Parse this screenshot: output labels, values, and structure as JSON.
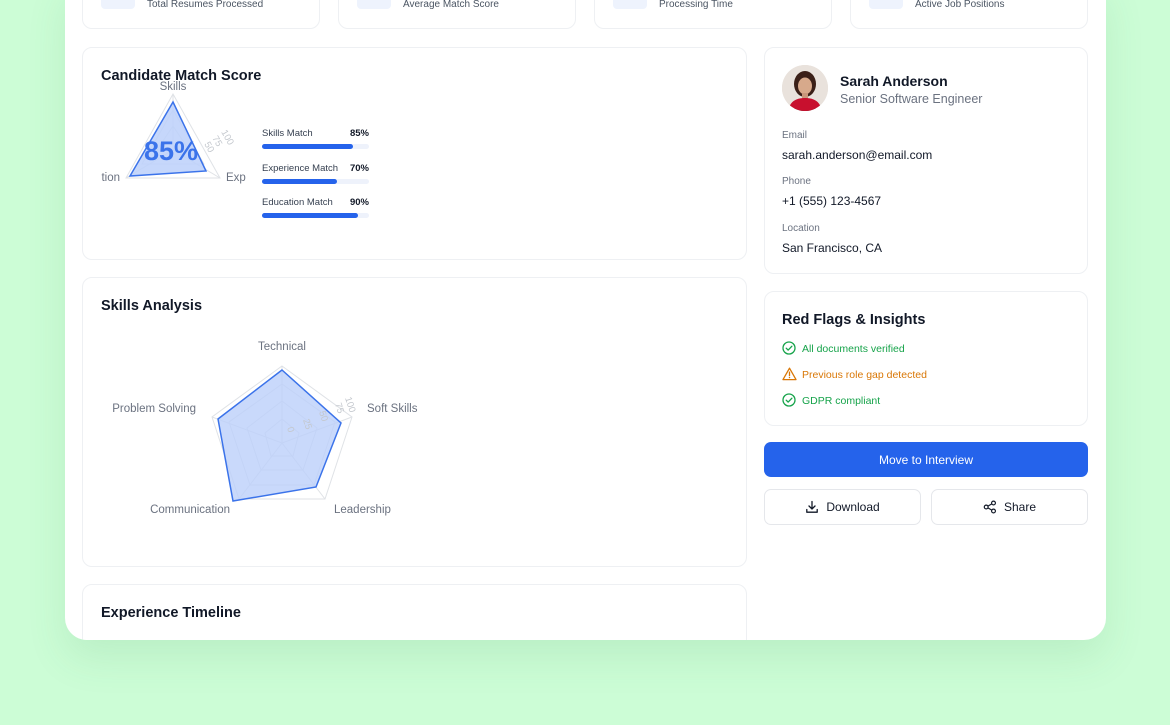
{
  "stats": [
    {
      "label": "Total Resumes Processed"
    },
    {
      "label": "Average Match Score"
    },
    {
      "label": "Processing Time"
    },
    {
      "label": "Active Job Positions"
    }
  ],
  "match_card": {
    "title": "Candidate Match Score",
    "radar_value": "85%",
    "axes": [
      "Skills",
      "Exp",
      "tion"
    ],
    "ticks": [
      "100",
      "75",
      "50"
    ],
    "bars": [
      {
        "label": "Skills Match",
        "value_text": "85%",
        "value": 85
      },
      {
        "label": "Experience Match",
        "value_text": "70%",
        "value": 70
      },
      {
        "label": "Education Match",
        "value_text": "90%",
        "value": 90
      }
    ]
  },
  "skills_card": {
    "title": "Skills Analysis",
    "axes": [
      "Technical",
      "Soft Skills",
      "Leadership",
      "Communication",
      "Problem Solving"
    ],
    "ticks": [
      "100",
      "75",
      "50",
      "25",
      "0"
    ]
  },
  "timeline_card": {
    "title": "Experience Timeline"
  },
  "profile": {
    "name": "Sarah Anderson",
    "role": "Senior Software Engineer",
    "email_label": "Email",
    "email": "sarah.anderson@email.com",
    "phone_label": "Phone",
    "phone": "+1 (555) 123-4567",
    "location_label": "Location",
    "location": "San Francisco, CA"
  },
  "insights": {
    "title": "Red Flags & Insights",
    "items": [
      {
        "text": "All documents verified",
        "status": "ok"
      },
      {
        "text": "Previous role gap detected",
        "status": "warn"
      },
      {
        "text": "GDPR compliant",
        "status": "ok"
      }
    ]
  },
  "actions": {
    "primary": "Move to Interview",
    "download": "Download",
    "share": "Share"
  },
  "colors": {
    "accent": "#2563eb",
    "success": "#16a34a",
    "warning": "#d97706",
    "background": "#ccfdd6"
  }
}
